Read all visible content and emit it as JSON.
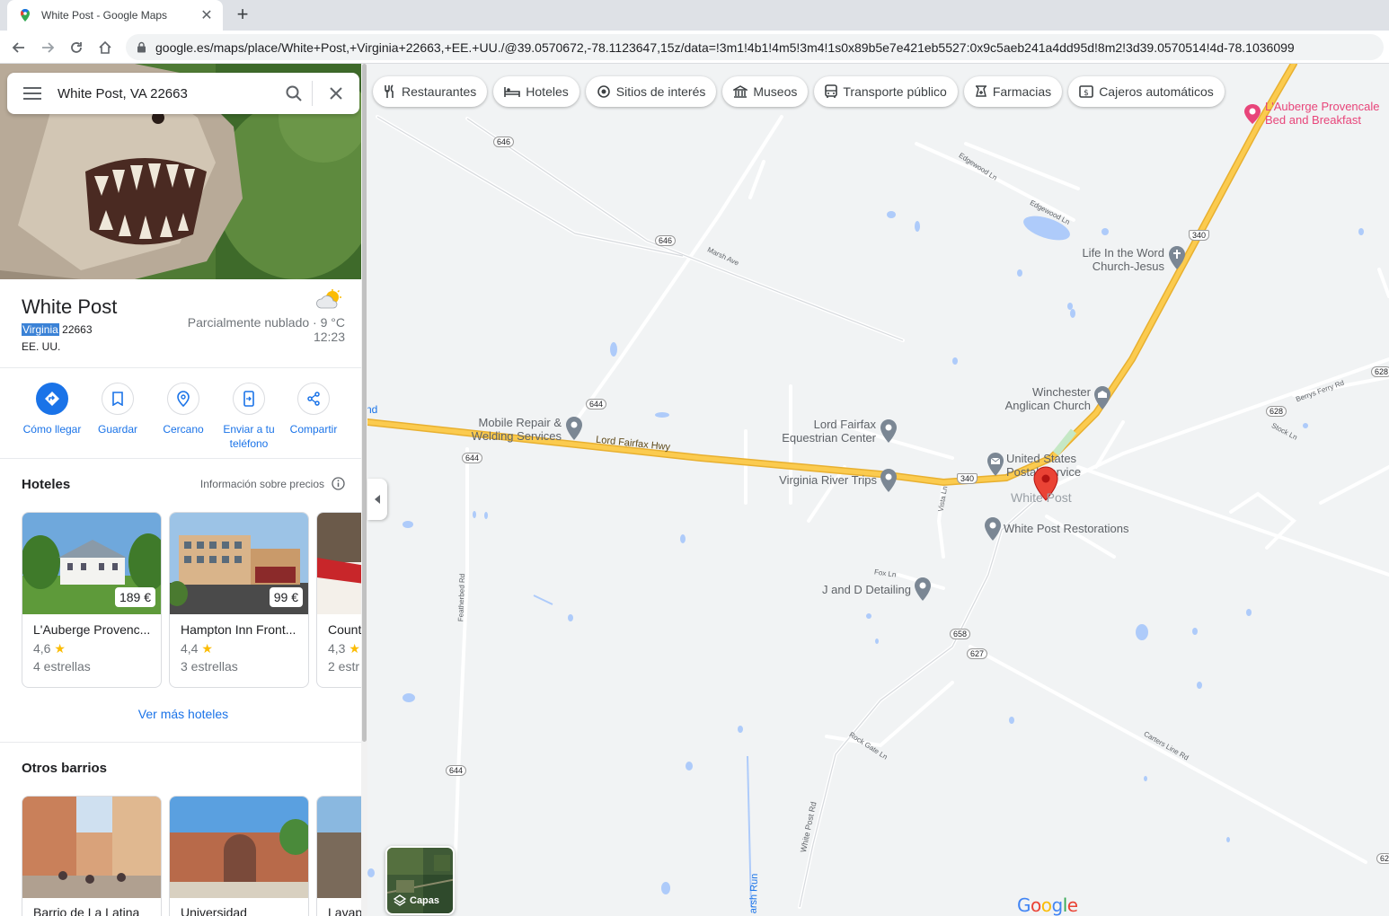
{
  "browser": {
    "tab_title": "White Post - Google Maps",
    "url": "google.es/maps/place/White+Post,+Virginia+22663,+EE.+UU./@39.0570672,-78.1123647,15z/data=!3m1!4b1!4m5!3m4!1s0x89b5e7e421eb5527:0x9c5aeb241a4dd95d!8m2!3d39.0570514!4d-78.1036099"
  },
  "search": {
    "query": "White Post, VA 22663"
  },
  "place": {
    "name": "White Post",
    "region_highlight": "Virginia",
    "postal": " 22663",
    "country": "EE. UU.",
    "weather": "Parcialmente nublado · 9 °C",
    "time": "12:23"
  },
  "actions": {
    "directions": "Cómo llegar",
    "save": "Guardar",
    "nearby": "Cercano",
    "send_line1": "Enviar a tu",
    "send_line2": "teléfono",
    "share": "Compartir"
  },
  "hotels": {
    "title": "Hoteles",
    "price_info": "Información sobre precios",
    "items": [
      {
        "name": "L'Auberge Provenc...",
        "price": "189 €",
        "rating": "4,6",
        "stars": "4 estrellas"
      },
      {
        "name": "Hampton Inn Front...",
        "price": "99 €",
        "rating": "4,4",
        "stars": "3 estrellas"
      },
      {
        "name": "Count",
        "price": "",
        "rating": "4,3",
        "stars": "2 estr"
      }
    ],
    "more": "Ver más hoteles"
  },
  "barrios": {
    "title": "Otros barrios",
    "items": [
      {
        "name": "Barrio de La Latina"
      },
      {
        "name": "Universidad"
      },
      {
        "name": "Lavap"
      }
    ]
  },
  "chips": [
    {
      "label": "Restaurantes",
      "icon": "fork-knife-icon"
    },
    {
      "label": "Hoteles",
      "icon": "bed-icon"
    },
    {
      "label": "Sitios de interés",
      "icon": "camera-icon"
    },
    {
      "label": "Museos",
      "icon": "museum-icon"
    },
    {
      "label": "Transporte público",
      "icon": "bus-icon"
    },
    {
      "label": "Farmacias",
      "icon": "pharmacy-icon"
    },
    {
      "label": "Cajeros automáticos",
      "icon": "atm-icon"
    }
  ],
  "map": {
    "layers_label": "Capas",
    "google": "Google",
    "pois": {
      "auberge_1": "L'Auberge Provencale",
      "auberge_2": "Bed and Breakfast",
      "church1_1": "Life In the Word",
      "church1_2": "Church-Jesus",
      "church2_1": "Winchester",
      "church2_2": "Anglican Church",
      "mobile_1": "Mobile Repair &",
      "mobile_2": "Welding Services",
      "lordfairfax_1": "Lord Fairfax",
      "lordfairfax_2": "Equestrian Center",
      "usps_1": "United States",
      "usps_2": "Postal Service",
      "vrt": "Virginia River Trips",
      "whitepost": "White Post",
      "restorations": "White Post Restorations",
      "detailing": "J and D Detailing"
    },
    "roads": {
      "hwy": "Lord Fairfax Hwy",
      "edgewood1": "Edgewood Ln",
      "edgewood2": "Edgewood Ln",
      "marsh": "Marsh Ave",
      "berrys": "Berrys Ferry Rd",
      "stock": "Stock Ln",
      "vista": "Vista Ln",
      "fox": "Fox Ln",
      "featherbed": "Featherbed Rd",
      "rockgate": "Rock Gate Ln",
      "whitepostrd": "White Post Rd",
      "carters": "Carters Line Rd",
      "marshrun": "arsh Run",
      "nd": "nd"
    },
    "shields": {
      "r646a": "646",
      "r646b": "646",
      "r644a": "644",
      "r644b": "644",
      "r644c": "644",
      "r340a": "340",
      "r340b": "340",
      "r628a": "628",
      "r628b": "628",
      "r658": "658",
      "r627": "627",
      "r62x": "62"
    }
  },
  "colors": {
    "accent": "#1a73e8",
    "highway": "#fbcb4f",
    "highway_border": "#e8b030",
    "water": "#aecbfa",
    "map_bg": "#f1f3f4",
    "poi_gray": "#7b8794",
    "poi_pink": "#e8457a",
    "pin_red": "#ea4335"
  }
}
